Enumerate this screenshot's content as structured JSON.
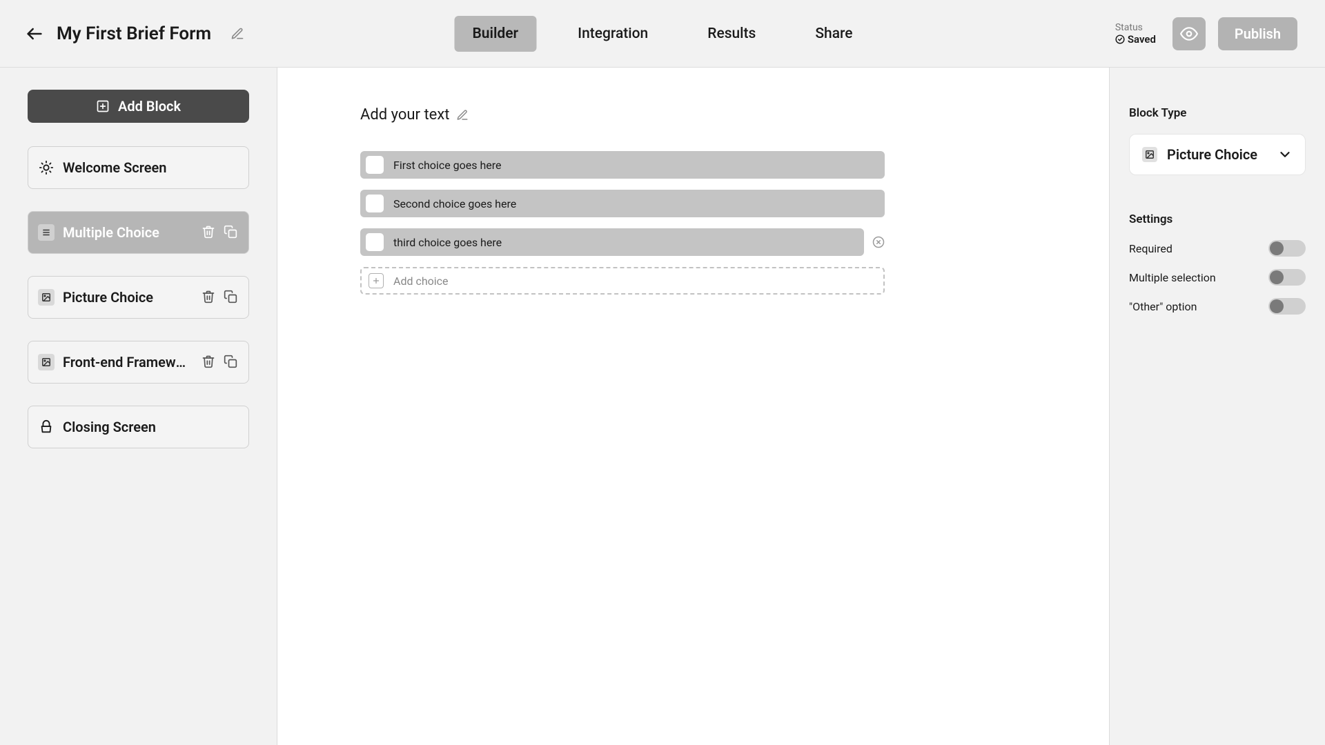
{
  "header": {
    "title": "My First Brief Form",
    "nav": [
      {
        "label": "Builder",
        "active": true
      },
      {
        "label": "Integration",
        "active": false
      },
      {
        "label": "Results",
        "active": false
      },
      {
        "label": "Share",
        "active": false
      }
    ],
    "status_label": "Status",
    "status_value": "Saved",
    "publish_label": "Publish"
  },
  "sidebar": {
    "add_block_label": "Add Block",
    "blocks": [
      {
        "label": "Welcome Screen",
        "icon": "sun",
        "selected": false,
        "has_actions": false
      },
      {
        "label": "Multiple Choice",
        "icon": "box",
        "selected": true,
        "has_actions": true
      },
      {
        "label": "Picture Choice",
        "icon": "box",
        "selected": false,
        "has_actions": true
      },
      {
        "label": "Front-end Framework",
        "icon": "box",
        "selected": false,
        "has_actions": true
      },
      {
        "label": "Closing Screen",
        "icon": "wave",
        "selected": false,
        "has_actions": false
      }
    ]
  },
  "canvas": {
    "prompt": "Add your text",
    "choices": [
      {
        "text": "First choice goes here",
        "removable": false
      },
      {
        "text": "Second choice goes here",
        "removable": false
      },
      {
        "text": "third choice goes here",
        "removable": true
      }
    ],
    "add_choice_label": "Add choice"
  },
  "right_panel": {
    "block_type_heading": "Block Type",
    "block_type_value": "Picture Choice",
    "settings_heading": "Settings",
    "settings": [
      {
        "label": "Required",
        "on": false
      },
      {
        "label": "Multiple selection",
        "on": false
      },
      {
        "label": "\"Other\" option",
        "on": false
      }
    ]
  }
}
